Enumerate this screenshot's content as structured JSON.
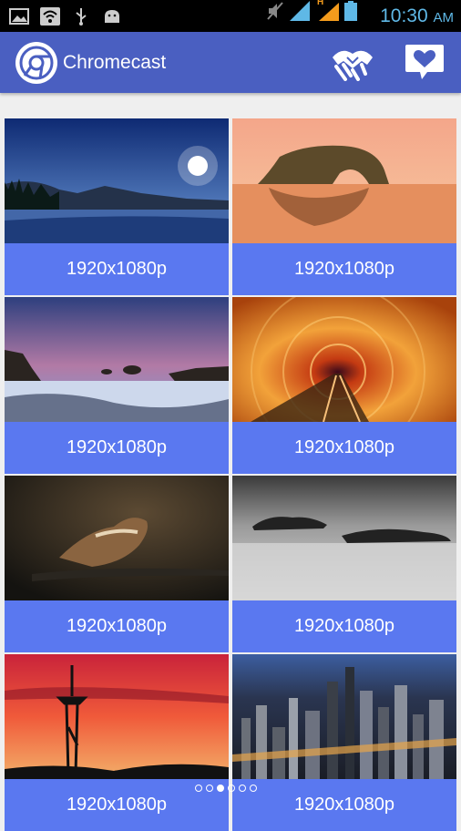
{
  "status_bar": {
    "time": "10:30",
    "ampm": "AM",
    "network": "H"
  },
  "app_bar": {
    "title": "Chromecast"
  },
  "wallpapers": [
    {
      "resolution": "1920x1080p",
      "subject": "night-lake"
    },
    {
      "resolution": "1920x1080p",
      "subject": "sea-arch"
    },
    {
      "resolution": "1920x1080p",
      "subject": "rocky-shore"
    },
    {
      "resolution": "1920x1080p",
      "subject": "light-tunnel"
    },
    {
      "resolution": "1920x1080p",
      "subject": "sparrow"
    },
    {
      "resolution": "1920x1080p",
      "subject": "misty-rocks"
    },
    {
      "resolution": "1920x1080p",
      "subject": "space-needle-sunset"
    },
    {
      "resolution": "1920x1080p",
      "subject": "city-night"
    }
  ],
  "pager": {
    "count": 6,
    "active": 2
  },
  "colors": {
    "app_bar": "#4a5fc1",
    "caption": "#5a78f0",
    "status_icons": "#5fb8e6"
  }
}
